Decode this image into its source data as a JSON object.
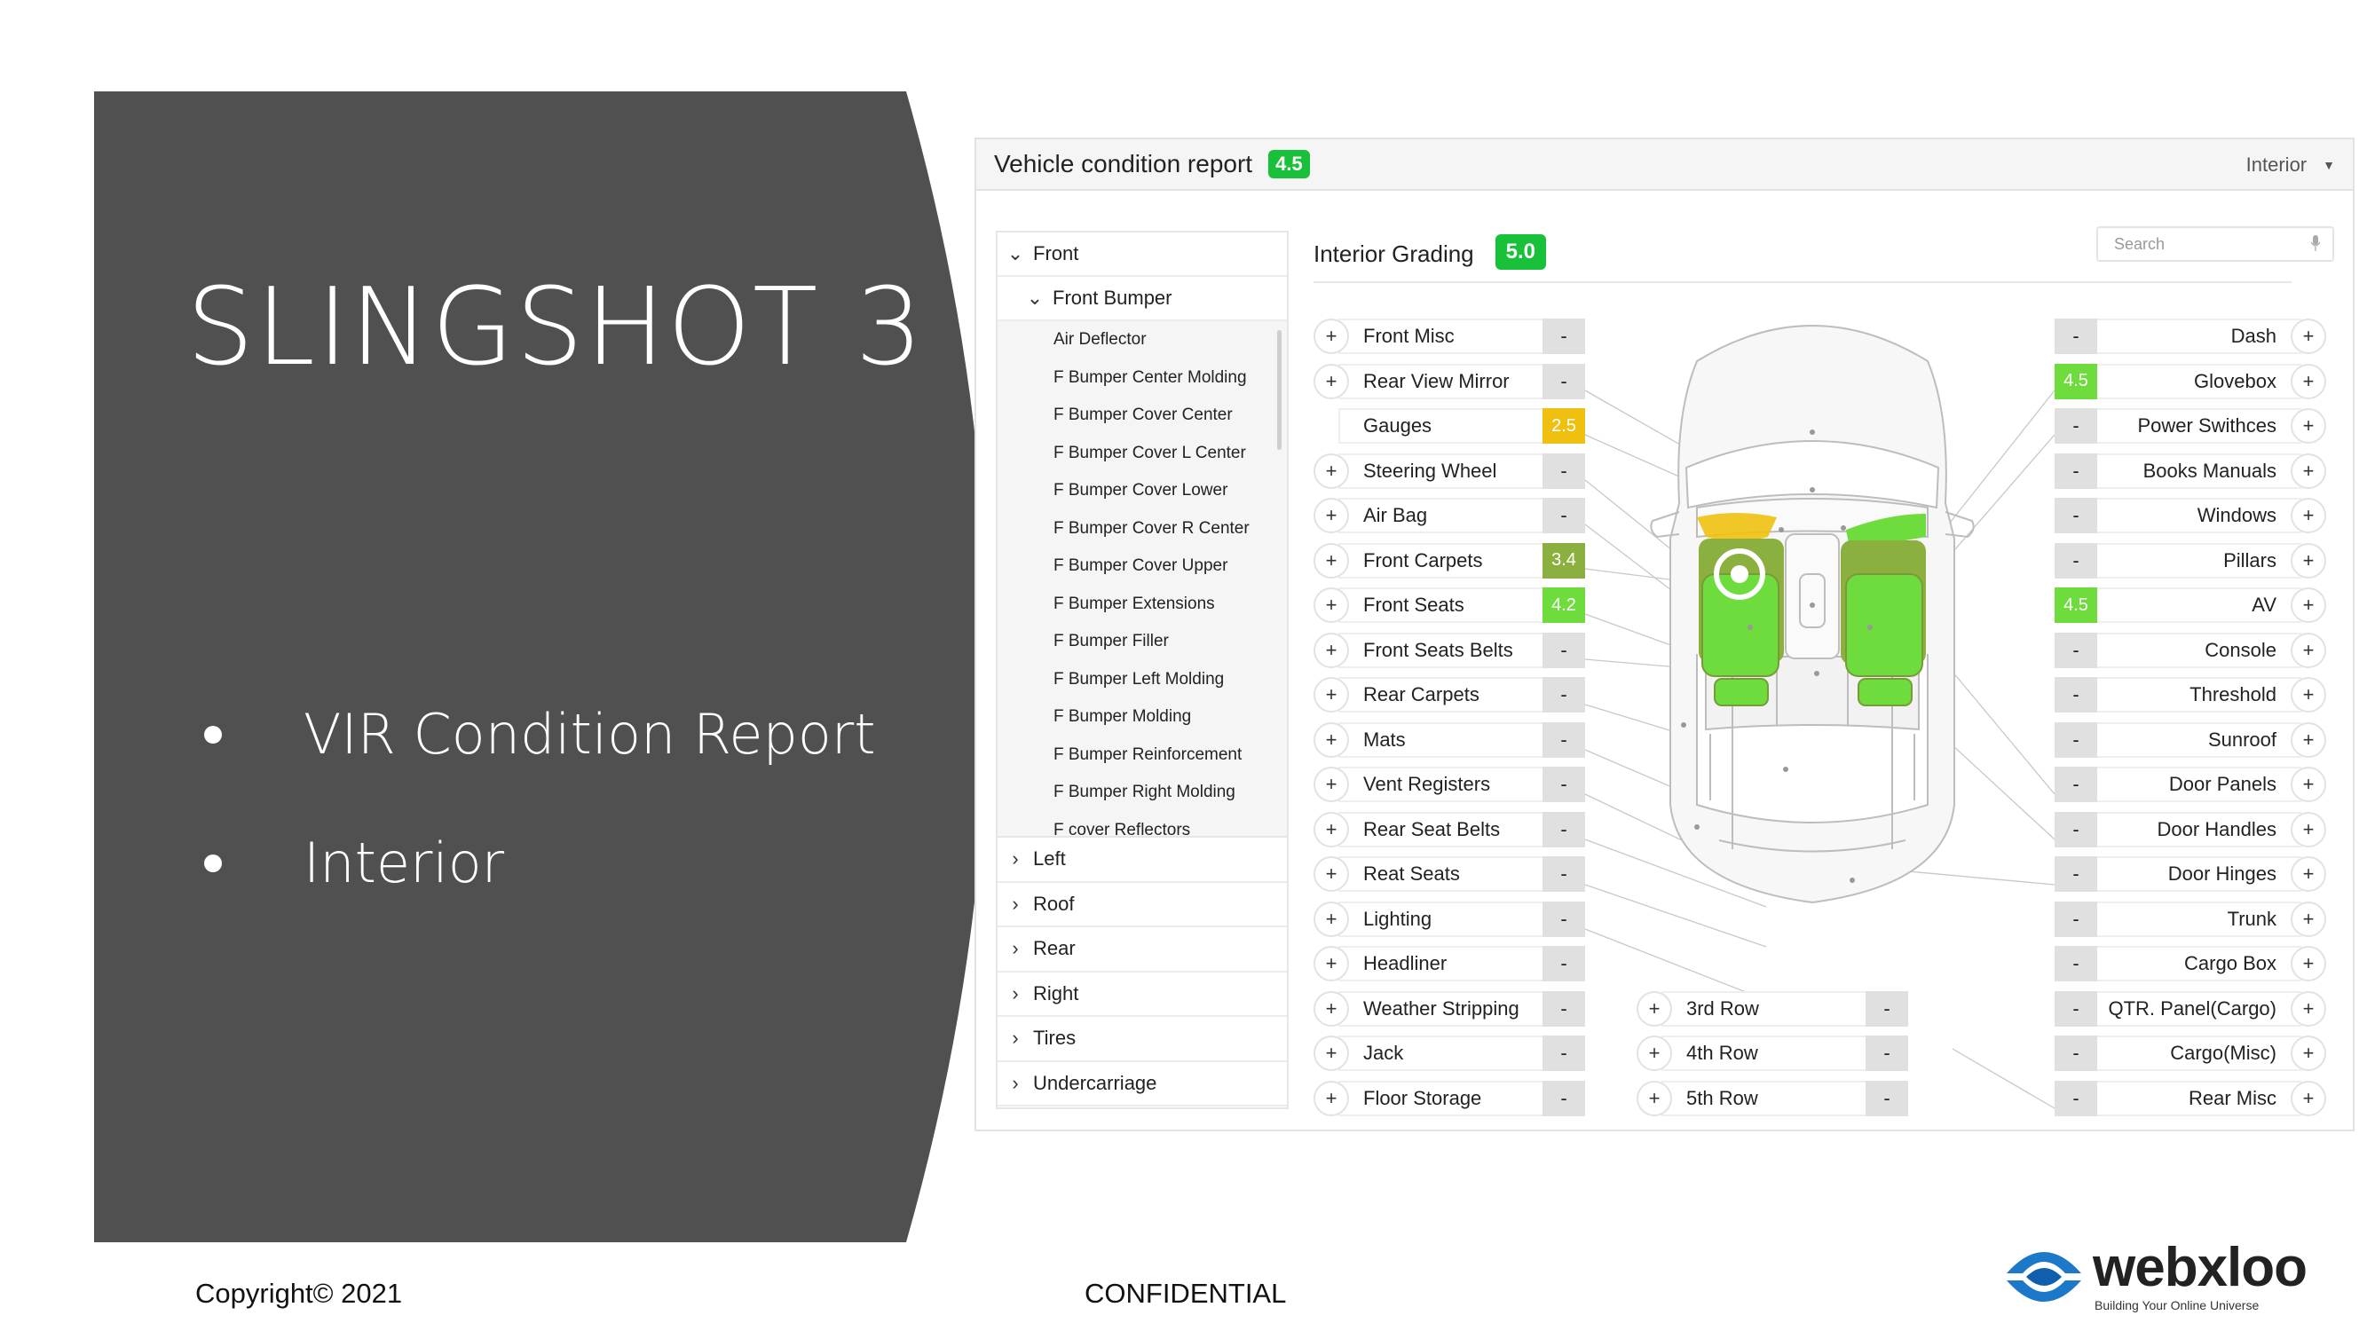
{
  "slide": {
    "title": "SLINGSHOT 3",
    "bullets": [
      "VIR Condition Report",
      "Interior"
    ],
    "footer_copyright": "Copyright© 2021",
    "footer_confidential": "CONFIDENTIAL",
    "logo_text": "webxloo",
    "logo_tagline": "Building Your Online Universe",
    "panel_color": "#505050"
  },
  "app": {
    "title": "Vehicle condition report",
    "overall_score": "4.5",
    "view_selector": "Interior",
    "grading_title": "Interior Grading",
    "grading_score": "5.0",
    "search_placeholder": "Search",
    "colors": {
      "good": "#19c13a",
      "light_green": "#6ddc3c",
      "olive": "#8cb040",
      "yellow": "#f0c010",
      "neutral": "#e0e0e0"
    }
  },
  "tree": {
    "front": "Front",
    "front_bumper": "Front Bumper",
    "front_bumper_items": [
      "Air Deflector",
      "F Bumper Center Molding",
      "F Bumper Cover Center",
      "F Bumper Cover L Center",
      "F Bumper Cover Lower",
      "F Bumper Cover R Center",
      "F Bumper Cover Upper",
      "F Bumper Extensions",
      "F Bumper Filler",
      "F Bumper Left Molding",
      "F Bumper Molding",
      "F Bumper Reinforcement",
      "F Bumper Right Molding",
      "F cover Reflectors"
    ],
    "sections": [
      "Left",
      "Roof",
      "Rear",
      "Right",
      "Tires",
      "Undercarriage"
    ]
  },
  "left_items": [
    {
      "label": "Front Misc",
      "value": "-"
    },
    {
      "label": "Rear View Mirror",
      "value": "-"
    },
    {
      "label": "Gauges",
      "value": "2.5",
      "color": "#f0c010",
      "no_plus": true
    },
    {
      "label": "Steering Wheel",
      "value": "-"
    },
    {
      "label": "Air Bag",
      "value": "-"
    },
    {
      "label": "Front Carpets",
      "value": "3.4",
      "color": "#8cb040"
    },
    {
      "label": "Front Seats",
      "value": "4.2",
      "color": "#6ddc3c"
    },
    {
      "label": "Front Seats Belts",
      "value": "-"
    },
    {
      "label": "Rear Carpets",
      "value": "-"
    },
    {
      "label": "Mats",
      "value": "-"
    },
    {
      "label": "Vent Registers",
      "value": "-"
    },
    {
      "label": "Rear Seat Belts",
      "value": "-"
    },
    {
      "label": "Reat Seats",
      "value": "-"
    },
    {
      "label": "Lighting",
      "value": "-"
    },
    {
      "label": "Headliner",
      "value": "-"
    },
    {
      "label": "Weather Stripping",
      "value": "-"
    },
    {
      "label": "Jack",
      "value": "-"
    },
    {
      "label": "Floor Storage",
      "value": "-"
    }
  ],
  "middle_items": [
    {
      "label": "3rd Row",
      "value": "-"
    },
    {
      "label": "4th Row",
      "value": "-"
    },
    {
      "label": "5th Row",
      "value": "-"
    }
  ],
  "right_items": [
    {
      "label": "Dash",
      "value": "-"
    },
    {
      "label": "Glovebox",
      "value": "4.5",
      "color": "#6ddc3c"
    },
    {
      "label": "Power Swithces",
      "value": "-"
    },
    {
      "label": "Books Manuals",
      "value": "-"
    },
    {
      "label": "Windows",
      "value": "-"
    },
    {
      "label": "Pillars",
      "value": "-"
    },
    {
      "label": "AV",
      "value": "4.5",
      "color": "#6ddc3c"
    },
    {
      "label": "Console",
      "value": "-"
    },
    {
      "label": "Threshold",
      "value": "-"
    },
    {
      "label": "Sunroof",
      "value": "-"
    },
    {
      "label": "Door Panels",
      "value": "-"
    },
    {
      "label": "Door Handles",
      "value": "-"
    },
    {
      "label": "Door Hinges",
      "value": "-"
    },
    {
      "label": "Trunk",
      "value": "-"
    },
    {
      "label": "Cargo Box",
      "value": "-"
    },
    {
      "label": "QTR. Panel(Cargo)",
      "value": "-"
    },
    {
      "label": "Cargo(Misc)",
      "value": "-"
    },
    {
      "label": "Rear Misc",
      "value": "-"
    }
  ],
  "icons": {
    "expand": "chevron-down-icon",
    "collapse": "chevron-right-icon",
    "add": "plus-icon",
    "search": "microphone-icon",
    "dropdown": "caret-down-icon"
  }
}
